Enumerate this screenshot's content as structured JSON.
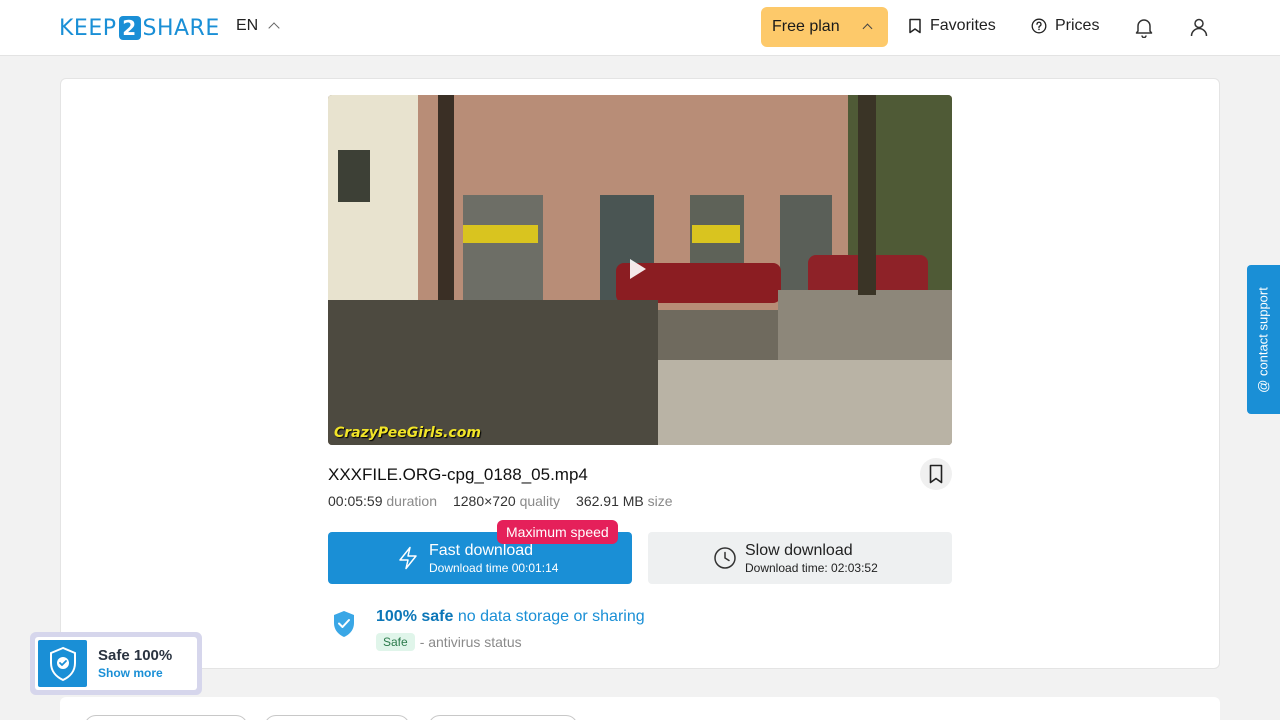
{
  "header": {
    "logo_left": "KEEP",
    "logo_num": "2",
    "logo_right": "SHARE",
    "lang": "EN",
    "plan_label": "Free plan",
    "favorites_label": "Favorites",
    "prices_label": "Prices"
  },
  "file": {
    "name": "XXXFILE.ORG-cpg_0188_05.mp4",
    "duration_value": "00:05:59",
    "duration_label": "duration",
    "quality_value": "1280×720",
    "quality_label": "quality",
    "size_value": "362.91 MB",
    "size_label": "size",
    "watermark": "CrazyPeeGirls.com"
  },
  "downloads": {
    "badge": "Maximum speed",
    "fast_title": "Fast download",
    "fast_sub": "Download time 00:01:14",
    "slow_title": "Slow download",
    "slow_sub": "Download time: 02:03:52"
  },
  "safety": {
    "bold": "100% safe",
    "rest": "no data storage or sharing",
    "pill": "Safe",
    "status": "- antivirus status"
  },
  "support_tab": "@ contact support",
  "safe_widget": {
    "title": "Safe 100%",
    "more": "Show more"
  },
  "colors": {
    "brand": "#1a8fd6",
    "plan": "#fdc96a",
    "badge": "#e5205a"
  }
}
